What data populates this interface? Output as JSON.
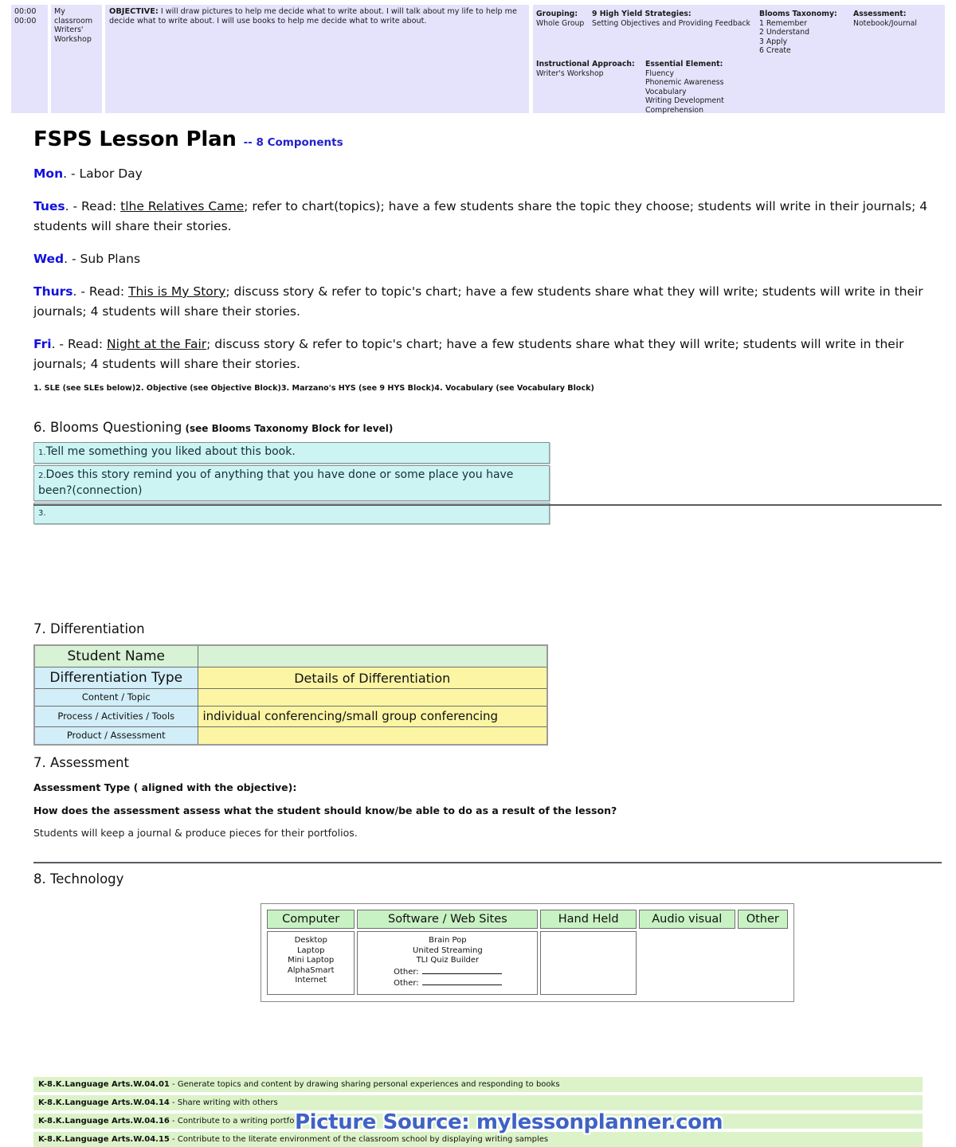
{
  "header": {
    "times": [
      "00:00",
      "00:00"
    ],
    "location_lines": [
      "My classroom",
      "Writers' Workshop"
    ],
    "objective_label": "OBJECTIVE:",
    "objective_text": " I will draw pictures to help me decide what to write about. I will talk about my life to help me decide what to write about. I will use books to help me decide what to write about.",
    "grouping_label": "Grouping:",
    "grouping_value": "Whole Group",
    "hys_label": "9 High Yield Strategies:",
    "hys_value": "Setting Objectives and Providing Feedback",
    "blooms_label": "Blooms Taxonomy:",
    "blooms_values": [
      "1 Remember",
      "2 Understand",
      "3 Apply",
      "6 Create"
    ],
    "assessment_label": "Assessment:",
    "assessment_value": "Notebook/Journal",
    "approach_label": "Instructional Approach:",
    "approach_value": "Writer's Workshop",
    "essential_label": "Essential Element:",
    "essential_values": [
      "Fluency",
      "Phonemic Awareness",
      "Vocabulary",
      "Writing Development",
      "Comprehension"
    ]
  },
  "title": {
    "main": "FSPS Lesson Plan",
    "sub": "-- 8 Components"
  },
  "days": [
    {
      "dow": "Mon",
      "sep": ". -",
      "pre": " Labor Day",
      "title": "",
      "post": ""
    },
    {
      "dow": "Tues",
      "sep": ". -",
      "pre": " Read: ",
      "title": "tlhe Relatives Came",
      "post": "; refer to chart(topics); have a few students share the topic they choose; students will write in their journals; 4 students will share their stories."
    },
    {
      "dow": "Wed",
      "sep": ". -",
      "pre": " Sub Plans",
      "title": "",
      "post": ""
    },
    {
      "dow": "Thurs",
      "sep": ". -",
      "pre": " Read: ",
      "title": "This is My Story",
      "post": "; discuss story & refer to topic's chart; have a few students share what they will write; students will write in their journals; 4 students will share their stories."
    },
    {
      "dow": "Fri",
      "sep": ". -",
      "pre": " Read: ",
      "title": "Night at the Fair",
      "post": "; discuss story & refer to topic's chart; have a few students share what they will write; students will write in their journals; 4 students will share their stories."
    }
  ],
  "sle_line": "1. SLE (see SLEs below)2. Objective (see Objective Block)3. Marzano's HYS (see 9 HYS Block)4. Vocabulary (see Vocabulary Block)",
  "blooms_section": {
    "heading": "6. Blooms Questioning",
    "note": " (see Blooms Taxonomy Block for level)",
    "questions": [
      {
        "num": "1.",
        "text": "Tell me something you liked about this book."
      },
      {
        "num": "2.",
        "text": "Does this story remind you of anything that you have done or some place you have been?(connection)"
      },
      {
        "num": "3.",
        "text": ""
      }
    ]
  },
  "differentiation": {
    "heading": "7. Differentiation",
    "student_name_label": "Student Name",
    "student_name_value": "",
    "type_label": "Differentiation Type",
    "details_label": "Details of Differentiation",
    "rows": [
      {
        "type": "Content / Topic",
        "details": ""
      },
      {
        "type": "Process / Activities / Tools",
        "details": "individual conferencing/small group conferencing"
      },
      {
        "type": "Product / Assessment",
        "details": ""
      }
    ]
  },
  "assessment": {
    "heading": "7.  Assessment",
    "type_label": "Assessment Type ( aligned with the objective):",
    "question": "How does the assessment assess what the student should know/be able to do as a result of the lesson?",
    "answer": "Students will keep a journal & produce pieces for their portfolios."
  },
  "technology": {
    "heading": "8. Technology",
    "columns": [
      "Computer",
      "Software / Web Sites",
      "Hand Held",
      "Audio visual",
      "Other"
    ],
    "computer_items": [
      "Desktop",
      "Laptop",
      "Mini Laptop",
      "AlphaSmart",
      "Internet"
    ],
    "software_items": [
      "Brain Pop",
      "United Streaming",
      "TLI Quiz Builder"
    ],
    "software_other_label_1": "Other:",
    "software_other_label_2": "Other:",
    "hand_held_items": [],
    "audio_visual_items": [],
    "other_items": []
  },
  "standards": [
    {
      "code": "K-8.K.Language Arts.W.04.01",
      "text": " - Generate topics and content by drawing sharing personal experiences and responding to books"
    },
    {
      "code": "K-8.K.Language Arts.W.04.14",
      "text": " - Share writing with others"
    },
    {
      "code": "K-8.K.Language Arts.W.04.16",
      "text": " - Contribute to a writing portfolio"
    },
    {
      "code": "K-8.K.Language Arts.W.04.15",
      "text": " - Contribute to the literate environment of the classroom school by displaying writing samples"
    }
  ],
  "watermark": "Picture Source: mylessonplanner.com"
}
